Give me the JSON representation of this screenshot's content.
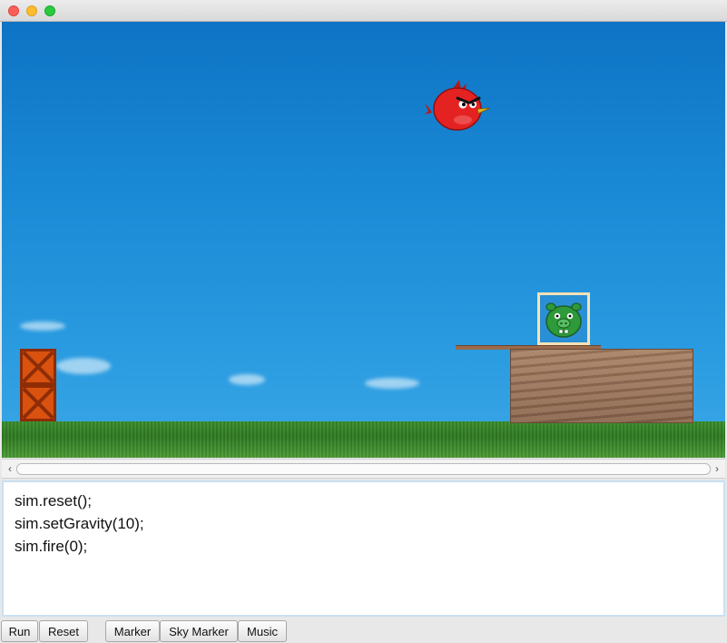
{
  "window": {
    "controls": [
      "close",
      "minimize",
      "zoom"
    ]
  },
  "scene": {
    "sprites": [
      "red-bird",
      "green-pig",
      "crate",
      "crate",
      "wood-block",
      "wood-plank"
    ]
  },
  "editor": {
    "lines": [
      "sim.reset();",
      "sim.setGravity(10);",
      "sim.fire(0);"
    ]
  },
  "toolbar": {
    "run_label": "Run",
    "reset_label": "Reset",
    "marker_label": "Marker",
    "sky_marker_label": "Sky Marker",
    "music_label": "Music"
  },
  "scrollbar": {
    "left_arrow": "‹",
    "right_arrow": "›"
  }
}
